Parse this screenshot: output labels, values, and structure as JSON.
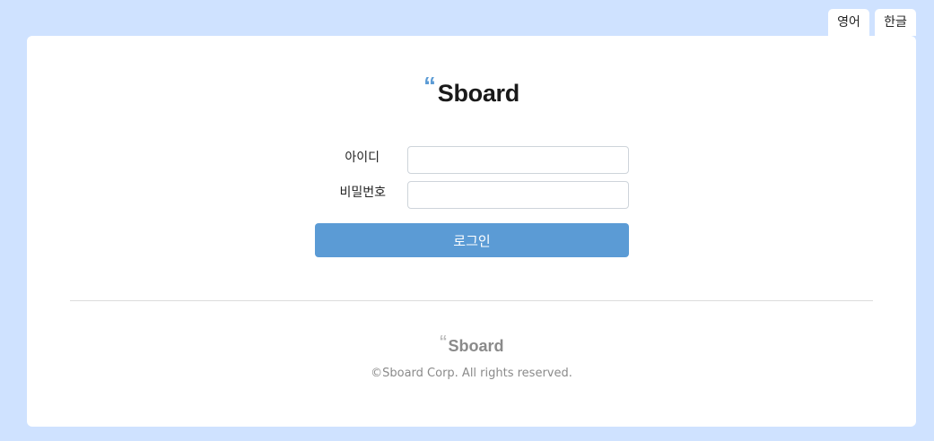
{
  "language_tabs": {
    "english": "영어",
    "korean": "한글"
  },
  "brand": {
    "quote_mark": "“",
    "name": "Sboard"
  },
  "login_form": {
    "id_label": "아이디",
    "id_value": "",
    "password_label": "비밀번호",
    "password_value": "",
    "submit_label": "로그인"
  },
  "footer": {
    "quote_mark": "“",
    "brand_name": "Sboard",
    "copyright": "©Sboard Corp. All rights reserved."
  },
  "colors": {
    "page_background": "#cfe2ff",
    "accent": "#5b9bd5",
    "card_background": "#ffffff"
  }
}
